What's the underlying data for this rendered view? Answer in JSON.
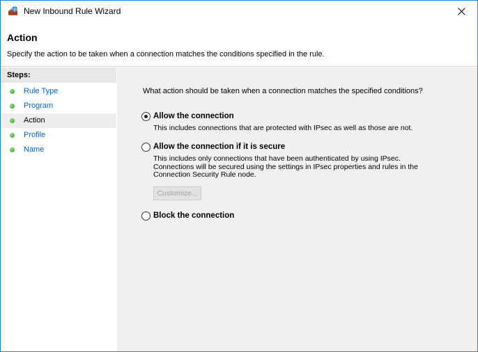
{
  "window": {
    "title": "New Inbound Rule Wizard"
  },
  "header": {
    "title": "Action",
    "description": "Specify the action to be taken when a connection matches the conditions specified in the rule."
  },
  "sidebar": {
    "heading": "Steps:",
    "items": [
      {
        "label": "Rule Type",
        "current": false
      },
      {
        "label": "Program",
        "current": false
      },
      {
        "label": "Action",
        "current": true
      },
      {
        "label": "Profile",
        "current": false
      },
      {
        "label": "Name",
        "current": false
      }
    ]
  },
  "main": {
    "question": "What action should be taken when a connection matches the specified conditions?",
    "selected_option": "allow",
    "options": [
      {
        "id": "allow",
        "label": "Allow the connection",
        "description": "This includes connections that are protected with IPsec as well as those are not."
      },
      {
        "id": "allow-secure",
        "label": "Allow the connection if it is secure",
        "description": "This includes only connections that have been authenticated by using IPsec.  Connections will be secured using the settings in IPsec properties and rules in the Connection Security Rule node.",
        "button_label": "Customize...",
        "button_enabled": false
      },
      {
        "id": "block",
        "label": "Block the connection"
      }
    ]
  },
  "colors": {
    "window_border": "#1883d7",
    "link": "#0066cc",
    "content_bg": "#f0f0f0",
    "steps_header_bg": "#e8e8e8",
    "status_dot": "#2f9a2a"
  },
  "icons": {
    "app": "firewall-icon",
    "close": "close-icon",
    "step": "green-dot-icon"
  }
}
